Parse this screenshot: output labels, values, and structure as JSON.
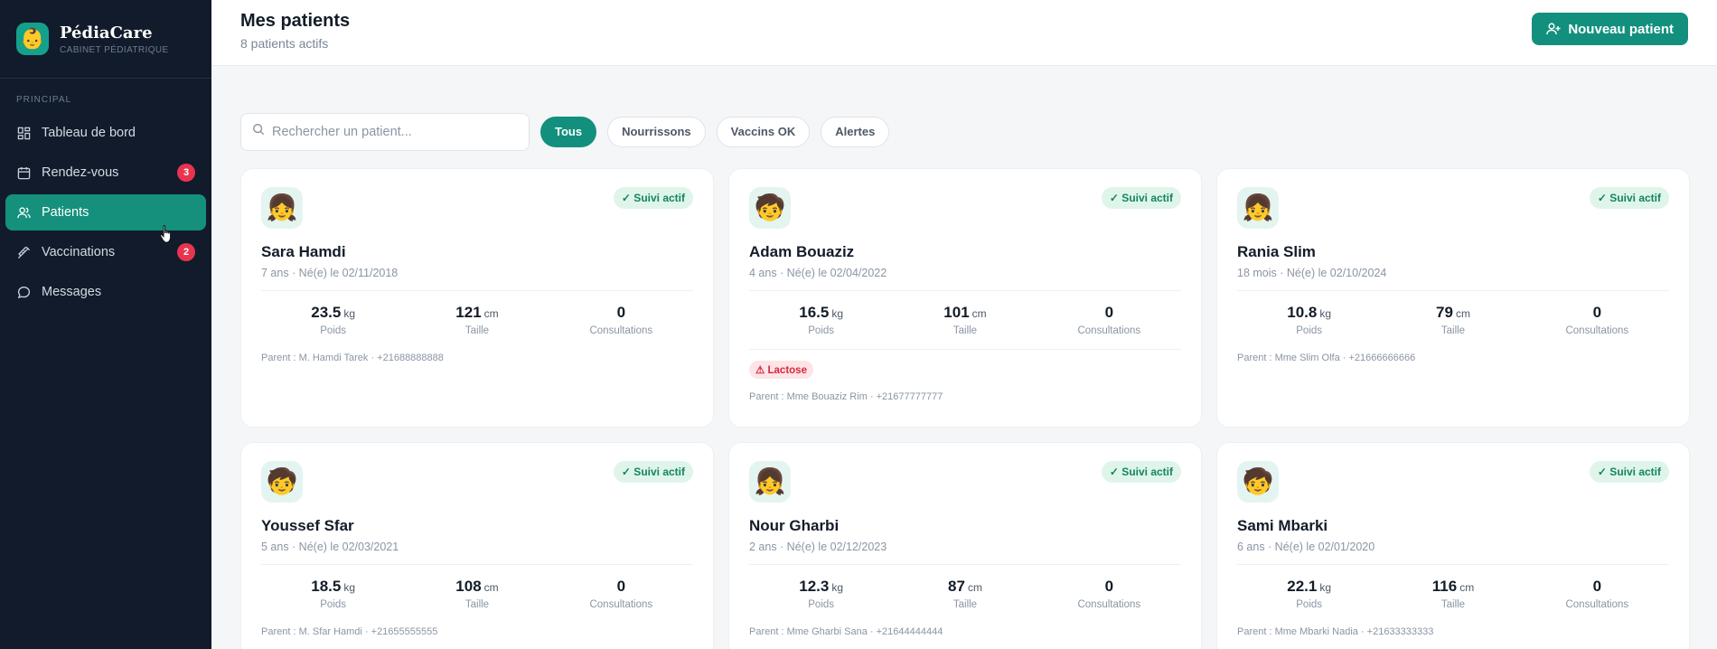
{
  "brand": {
    "name": "PédiaCare",
    "subtitle": "CABINET PÉDIATRIQUE",
    "logo_icon": "baby-face-icon"
  },
  "sidebar": {
    "section_label": "PRINCIPAL",
    "items": [
      {
        "label": "Tableau de bord",
        "icon": "dashboard-icon",
        "active": false,
        "badge": null
      },
      {
        "label": "Rendez-vous",
        "icon": "calendar-icon",
        "active": false,
        "badge": "3"
      },
      {
        "label": "Patients",
        "icon": "users-icon",
        "active": true,
        "badge": null
      },
      {
        "label": "Vaccinations",
        "icon": "syringe-icon",
        "active": false,
        "badge": "2"
      },
      {
        "label": "Messages",
        "icon": "chat-icon",
        "active": false,
        "badge": null
      }
    ]
  },
  "header": {
    "title": "Mes patients",
    "subtitle": "8 patients actifs",
    "new_button": "Nouveau patient"
  },
  "toolbar": {
    "search_placeholder": "Rechercher un patient...",
    "filters": [
      "Tous",
      "Nourrissons",
      "Vaccins OK",
      "Alertes"
    ],
    "active_filter": "Tous"
  },
  "labels": {
    "weight": "Poids",
    "height": "Taille",
    "consultations": "Consultations",
    "weight_unit": "kg",
    "height_unit": "cm"
  },
  "patients": [
    {
      "name": "Sara Hamdi",
      "meta": "7 ans · Né(e) le 02/11/2018",
      "status": "✓ Suivi actif",
      "weight": "23.5",
      "height": "121",
      "consultations": "0",
      "allergy": null,
      "parent": "Parent : M. Hamdi Tarek · +21688888888",
      "avatar": "girl-emoji"
    },
    {
      "name": "Adam Bouaziz",
      "meta": "4 ans · Né(e) le 02/04/2022",
      "status": "✓ Suivi actif",
      "weight": "16.5",
      "height": "101",
      "consultations": "0",
      "allergy": "⚠ Lactose",
      "parent": "Parent : Mme Bouaziz Rim · +21677777777",
      "avatar": "child-emoji"
    },
    {
      "name": "Rania Slim",
      "meta": "18 mois · Né(e) le 02/10/2024",
      "status": "✓ Suivi actif",
      "weight": "10.8",
      "height": "79",
      "consultations": "0",
      "allergy": null,
      "parent": "Parent : Mme Slim Olfa · +21666666666",
      "avatar": "girl-emoji"
    },
    {
      "name": "Youssef Sfar",
      "meta": "5 ans · Né(e) le 02/03/2021",
      "status": "✓ Suivi actif",
      "weight": "18.5",
      "height": "108",
      "consultations": "0",
      "allergy": null,
      "parent": "Parent : M. Sfar Hamdi · +21655555555",
      "avatar": "child-emoji"
    },
    {
      "name": "Nour Gharbi",
      "meta": "2 ans · Né(e) le 02/12/2023",
      "status": "✓ Suivi actif",
      "weight": "12.3",
      "height": "87",
      "consultations": "0",
      "allergy": null,
      "parent": "Parent : Mme Gharbi Sana · +21644444444",
      "avatar": "girl-emoji"
    },
    {
      "name": "Sami Mbarki",
      "meta": "6 ans · Né(e) le 02/01/2020",
      "status": "✓ Suivi actif",
      "weight": "22.1",
      "height": "116",
      "consultations": "0",
      "allergy": null,
      "parent": "Parent : Mme Mbarki Nadia · +21633333333",
      "avatar": "child-emoji"
    }
  ],
  "colors": {
    "accent": "#12907d",
    "sidebar_bg": "#111b2b",
    "badge": "#e8344e",
    "status_bg": "#dff5ea",
    "status_text": "#14845f",
    "allergy_bg": "#fde4e6",
    "allergy_text": "#d6283e"
  }
}
